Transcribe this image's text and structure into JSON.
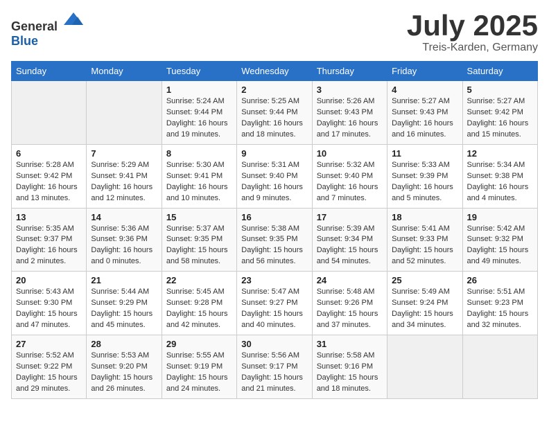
{
  "logo": {
    "text_general": "General",
    "text_blue": "Blue"
  },
  "title": "July 2025",
  "location": "Treis-Karden, Germany",
  "weekdays": [
    "Sunday",
    "Monday",
    "Tuesday",
    "Wednesday",
    "Thursday",
    "Friday",
    "Saturday"
  ],
  "weeks": [
    [
      {
        "day": "",
        "info": ""
      },
      {
        "day": "",
        "info": ""
      },
      {
        "day": "1",
        "info": "Sunrise: 5:24 AM\nSunset: 9:44 PM\nDaylight: 16 hours and 19 minutes."
      },
      {
        "day": "2",
        "info": "Sunrise: 5:25 AM\nSunset: 9:44 PM\nDaylight: 16 hours and 18 minutes."
      },
      {
        "day": "3",
        "info": "Sunrise: 5:26 AM\nSunset: 9:43 PM\nDaylight: 16 hours and 17 minutes."
      },
      {
        "day": "4",
        "info": "Sunrise: 5:27 AM\nSunset: 9:43 PM\nDaylight: 16 hours and 16 minutes."
      },
      {
        "day": "5",
        "info": "Sunrise: 5:27 AM\nSunset: 9:42 PM\nDaylight: 16 hours and 15 minutes."
      }
    ],
    [
      {
        "day": "6",
        "info": "Sunrise: 5:28 AM\nSunset: 9:42 PM\nDaylight: 16 hours and 13 minutes."
      },
      {
        "day": "7",
        "info": "Sunrise: 5:29 AM\nSunset: 9:41 PM\nDaylight: 16 hours and 12 minutes."
      },
      {
        "day": "8",
        "info": "Sunrise: 5:30 AM\nSunset: 9:41 PM\nDaylight: 16 hours and 10 minutes."
      },
      {
        "day": "9",
        "info": "Sunrise: 5:31 AM\nSunset: 9:40 PM\nDaylight: 16 hours and 9 minutes."
      },
      {
        "day": "10",
        "info": "Sunrise: 5:32 AM\nSunset: 9:40 PM\nDaylight: 16 hours and 7 minutes."
      },
      {
        "day": "11",
        "info": "Sunrise: 5:33 AM\nSunset: 9:39 PM\nDaylight: 16 hours and 5 minutes."
      },
      {
        "day": "12",
        "info": "Sunrise: 5:34 AM\nSunset: 9:38 PM\nDaylight: 16 hours and 4 minutes."
      }
    ],
    [
      {
        "day": "13",
        "info": "Sunrise: 5:35 AM\nSunset: 9:37 PM\nDaylight: 16 hours and 2 minutes."
      },
      {
        "day": "14",
        "info": "Sunrise: 5:36 AM\nSunset: 9:36 PM\nDaylight: 16 hours and 0 minutes."
      },
      {
        "day": "15",
        "info": "Sunrise: 5:37 AM\nSunset: 9:35 PM\nDaylight: 15 hours and 58 minutes."
      },
      {
        "day": "16",
        "info": "Sunrise: 5:38 AM\nSunset: 9:35 PM\nDaylight: 15 hours and 56 minutes."
      },
      {
        "day": "17",
        "info": "Sunrise: 5:39 AM\nSunset: 9:34 PM\nDaylight: 15 hours and 54 minutes."
      },
      {
        "day": "18",
        "info": "Sunrise: 5:41 AM\nSunset: 9:33 PM\nDaylight: 15 hours and 52 minutes."
      },
      {
        "day": "19",
        "info": "Sunrise: 5:42 AM\nSunset: 9:32 PM\nDaylight: 15 hours and 49 minutes."
      }
    ],
    [
      {
        "day": "20",
        "info": "Sunrise: 5:43 AM\nSunset: 9:30 PM\nDaylight: 15 hours and 47 minutes."
      },
      {
        "day": "21",
        "info": "Sunrise: 5:44 AM\nSunset: 9:29 PM\nDaylight: 15 hours and 45 minutes."
      },
      {
        "day": "22",
        "info": "Sunrise: 5:45 AM\nSunset: 9:28 PM\nDaylight: 15 hours and 42 minutes."
      },
      {
        "day": "23",
        "info": "Sunrise: 5:47 AM\nSunset: 9:27 PM\nDaylight: 15 hours and 40 minutes."
      },
      {
        "day": "24",
        "info": "Sunrise: 5:48 AM\nSunset: 9:26 PM\nDaylight: 15 hours and 37 minutes."
      },
      {
        "day": "25",
        "info": "Sunrise: 5:49 AM\nSunset: 9:24 PM\nDaylight: 15 hours and 34 minutes."
      },
      {
        "day": "26",
        "info": "Sunrise: 5:51 AM\nSunset: 9:23 PM\nDaylight: 15 hours and 32 minutes."
      }
    ],
    [
      {
        "day": "27",
        "info": "Sunrise: 5:52 AM\nSunset: 9:22 PM\nDaylight: 15 hours and 29 minutes."
      },
      {
        "day": "28",
        "info": "Sunrise: 5:53 AM\nSunset: 9:20 PM\nDaylight: 15 hours and 26 minutes."
      },
      {
        "day": "29",
        "info": "Sunrise: 5:55 AM\nSunset: 9:19 PM\nDaylight: 15 hours and 24 minutes."
      },
      {
        "day": "30",
        "info": "Sunrise: 5:56 AM\nSunset: 9:17 PM\nDaylight: 15 hours and 21 minutes."
      },
      {
        "day": "31",
        "info": "Sunrise: 5:58 AM\nSunset: 9:16 PM\nDaylight: 15 hours and 18 minutes."
      },
      {
        "day": "",
        "info": ""
      },
      {
        "day": "",
        "info": ""
      }
    ]
  ]
}
